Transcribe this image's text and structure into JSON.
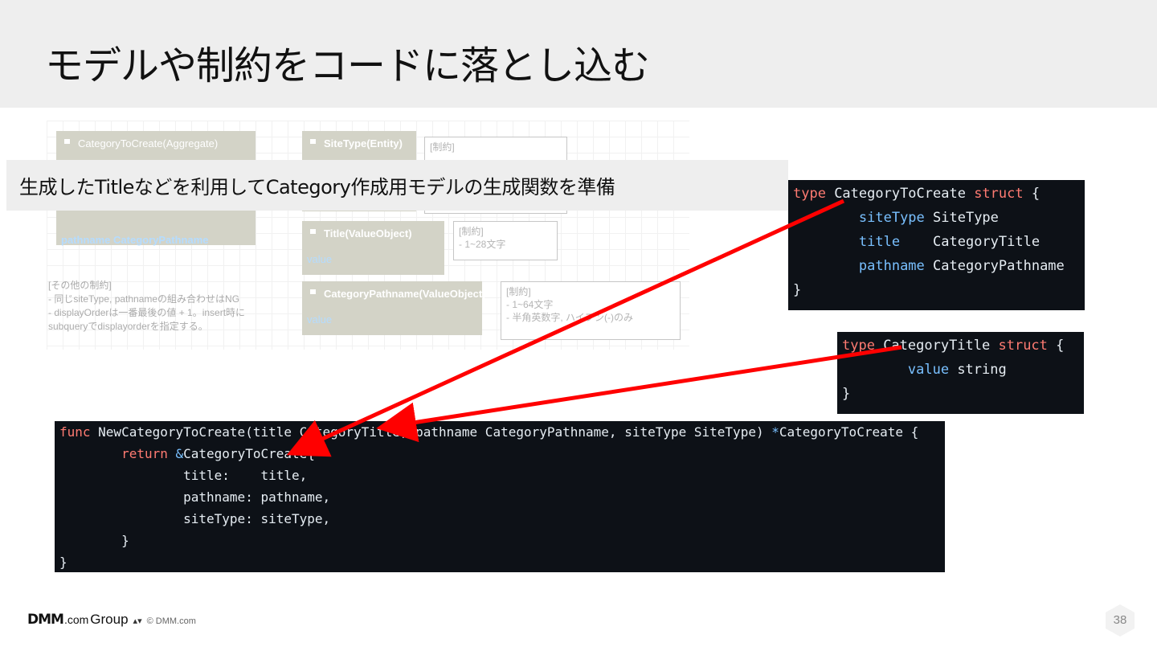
{
  "slide": {
    "title": "モデルや制約をコードに落とし込む",
    "callout": "生成したTitleなどを利用してCategory作成用モデルの生成関数を準備",
    "page_number": "38"
  },
  "diagram": {
    "aggregate_header": "CategoryToCreate(Aggregate)",
    "aggregate_field": "pathname CategoryPathname",
    "sitetype_header": "SiteType(Entity)",
    "sitetype_note": "[制約]",
    "title_header": "Title(ValueObject)",
    "title_field": "value",
    "title_note": "[制約]\n- 1~28文字",
    "pathname_header": "CategoryPathname(ValueObject)",
    "pathname_field": "value",
    "pathname_note": "[制約]\n- 1~64文字\n- 半角英数字, ハイフン(-)のみ",
    "other_constraints": "[その他の制約]\n- 同じsiteType, pathnameの組み合わせはNG\n- displayOrderは一番最後の値 + 1。insert時に\nsubqueryでdisplayorderを指定する。"
  },
  "code_struct": {
    "line1_kw": "type",
    "line1_name": " CategoryToCreate ",
    "line1_kw2": "struct",
    "line1_brace": " {",
    "f1_name": "siteType",
    "f1_type": " SiteType",
    "f2_name": "title",
    "f2_type": "    CategoryTitle",
    "f3_name": "pathname",
    "f3_type": " CategoryPathname",
    "close": "}"
  },
  "code_title": {
    "line1_kw": "type",
    "line1_name": " CategoryTitle ",
    "line1_kw2": "struct",
    "line1_brace": " {",
    "f1_name": "value",
    "f1_type": " string",
    "close": "}"
  },
  "code_func": {
    "kw_func": "func",
    "signature": " NewCategoryToCreate(title CategoryTitle, pathname CategoryPathname, siteType SiteType) ",
    "ptr": "*",
    "ret_type": "CategoryToCreate {",
    "kw_return": "return",
    "amp": "&",
    "literal": "CategoryToCreate{",
    "l3": "title:    title,",
    "l4": "pathname: pathname,",
    "l5": "siteType: siteType,",
    "l6": "}",
    "l7": "}"
  },
  "footer": {
    "logo_dmm": "DMM",
    "logo_com": ".com",
    "logo_group": "Group",
    "copyright": "© DMM.com"
  },
  "colors": {
    "header_bg": "#eeeeee",
    "code_bg": "#0d1117",
    "keyword": "#ff7b72",
    "field": "#79c0ff",
    "arrow": "#ff0000"
  }
}
